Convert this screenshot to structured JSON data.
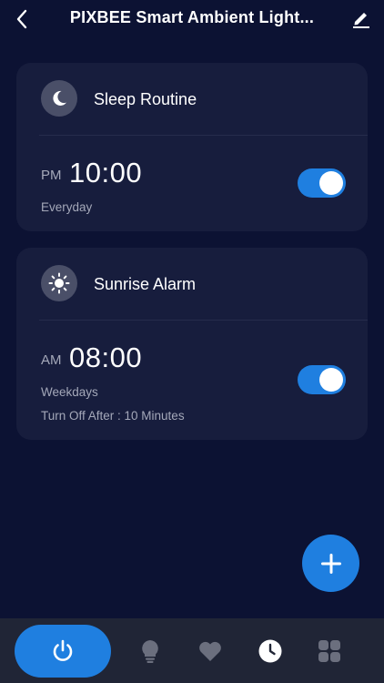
{
  "header": {
    "title": "PIXBEE Smart Ambient Light...",
    "back_icon": "chevron-left-icon",
    "edit_icon": "pencil-icon"
  },
  "schedules": [
    {
      "name": "Sleep Routine",
      "icon": "moon-icon",
      "period": "PM",
      "time": "10:00",
      "repeat": "Everyday",
      "enabled": true
    },
    {
      "name": "Sunrise Alarm",
      "icon": "sun-icon",
      "period": "AM",
      "time": "08:00",
      "repeat": "Weekdays",
      "turn_off": "Turn Off After : 10 Minutes",
      "enabled": true
    }
  ],
  "fab": {
    "icon": "plus-icon"
  },
  "bottom_nav": {
    "active": "schedule",
    "items": [
      {
        "id": "power",
        "icon": "power-icon"
      },
      {
        "id": "light",
        "icon": "bulb-icon"
      },
      {
        "id": "favorites",
        "icon": "heart-icon"
      },
      {
        "id": "schedule",
        "icon": "clock-icon"
      },
      {
        "id": "more",
        "icon": "grid-icon"
      }
    ]
  },
  "colors": {
    "background": "#0c1233",
    "card": "#171d3d",
    "accent": "#1f7fe0",
    "muted_text": "#a4a8b9",
    "nav_bar": "#202536",
    "inactive_icon": "#6b6f7e"
  }
}
